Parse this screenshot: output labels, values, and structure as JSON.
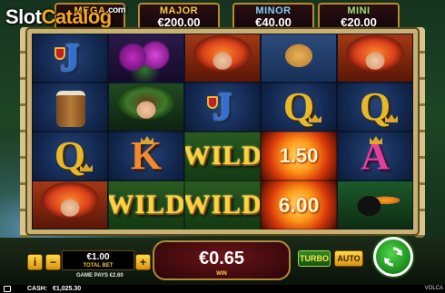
{
  "watermark": {
    "text_a": "Slot",
    "text_b": "Catalog",
    "com": ".com"
  },
  "jackpots": [
    {
      "name": "MEGA",
      "value": ""
    },
    {
      "name": "MAJOR",
      "value": "€200.00"
    },
    {
      "name": "MINOR",
      "value": "€40.00"
    },
    {
      "name": "MINI",
      "value": "€20.00"
    }
  ],
  "reels": {
    "row1": [
      "J",
      "orchid",
      "woman",
      "jaguar",
      "woman"
    ],
    "row2": [
      "drum",
      "woman-green",
      "J",
      "Q",
      "Q"
    ],
    "row3": [
      "Q",
      "K",
      "WILD",
      "1.50",
      "A"
    ],
    "row4": [
      "woman",
      "WILD",
      "WILD",
      "6.00",
      "toucan"
    ]
  },
  "symbols": {
    "J": "J",
    "Q": "Q",
    "K": "K",
    "A": "A",
    "wild": "WILD",
    "fire1": "1.50",
    "fire2": "6.00"
  },
  "bet": {
    "value": "€1.00",
    "label": "TOTAL BET",
    "minus": "−",
    "plus": "+",
    "info": "i"
  },
  "game_pays": "GAME PAYS €2.60",
  "win": {
    "value": "€0.65",
    "label": "WIN"
  },
  "turbo_label": "TURBO",
  "auto_label": "AUTO",
  "status": {
    "cash_label": "CASH:",
    "cash_value": "€1,025.30",
    "brand": "VOLCA"
  },
  "colors": {
    "frame": "#c9b073",
    "spin": "#1a8a1a",
    "win_bg": "#6a1418",
    "accent": "#ffd23a"
  },
  "icons": {
    "spin": "refresh-arrows-icon",
    "menu": "menu-icon",
    "info": "info-icon"
  }
}
